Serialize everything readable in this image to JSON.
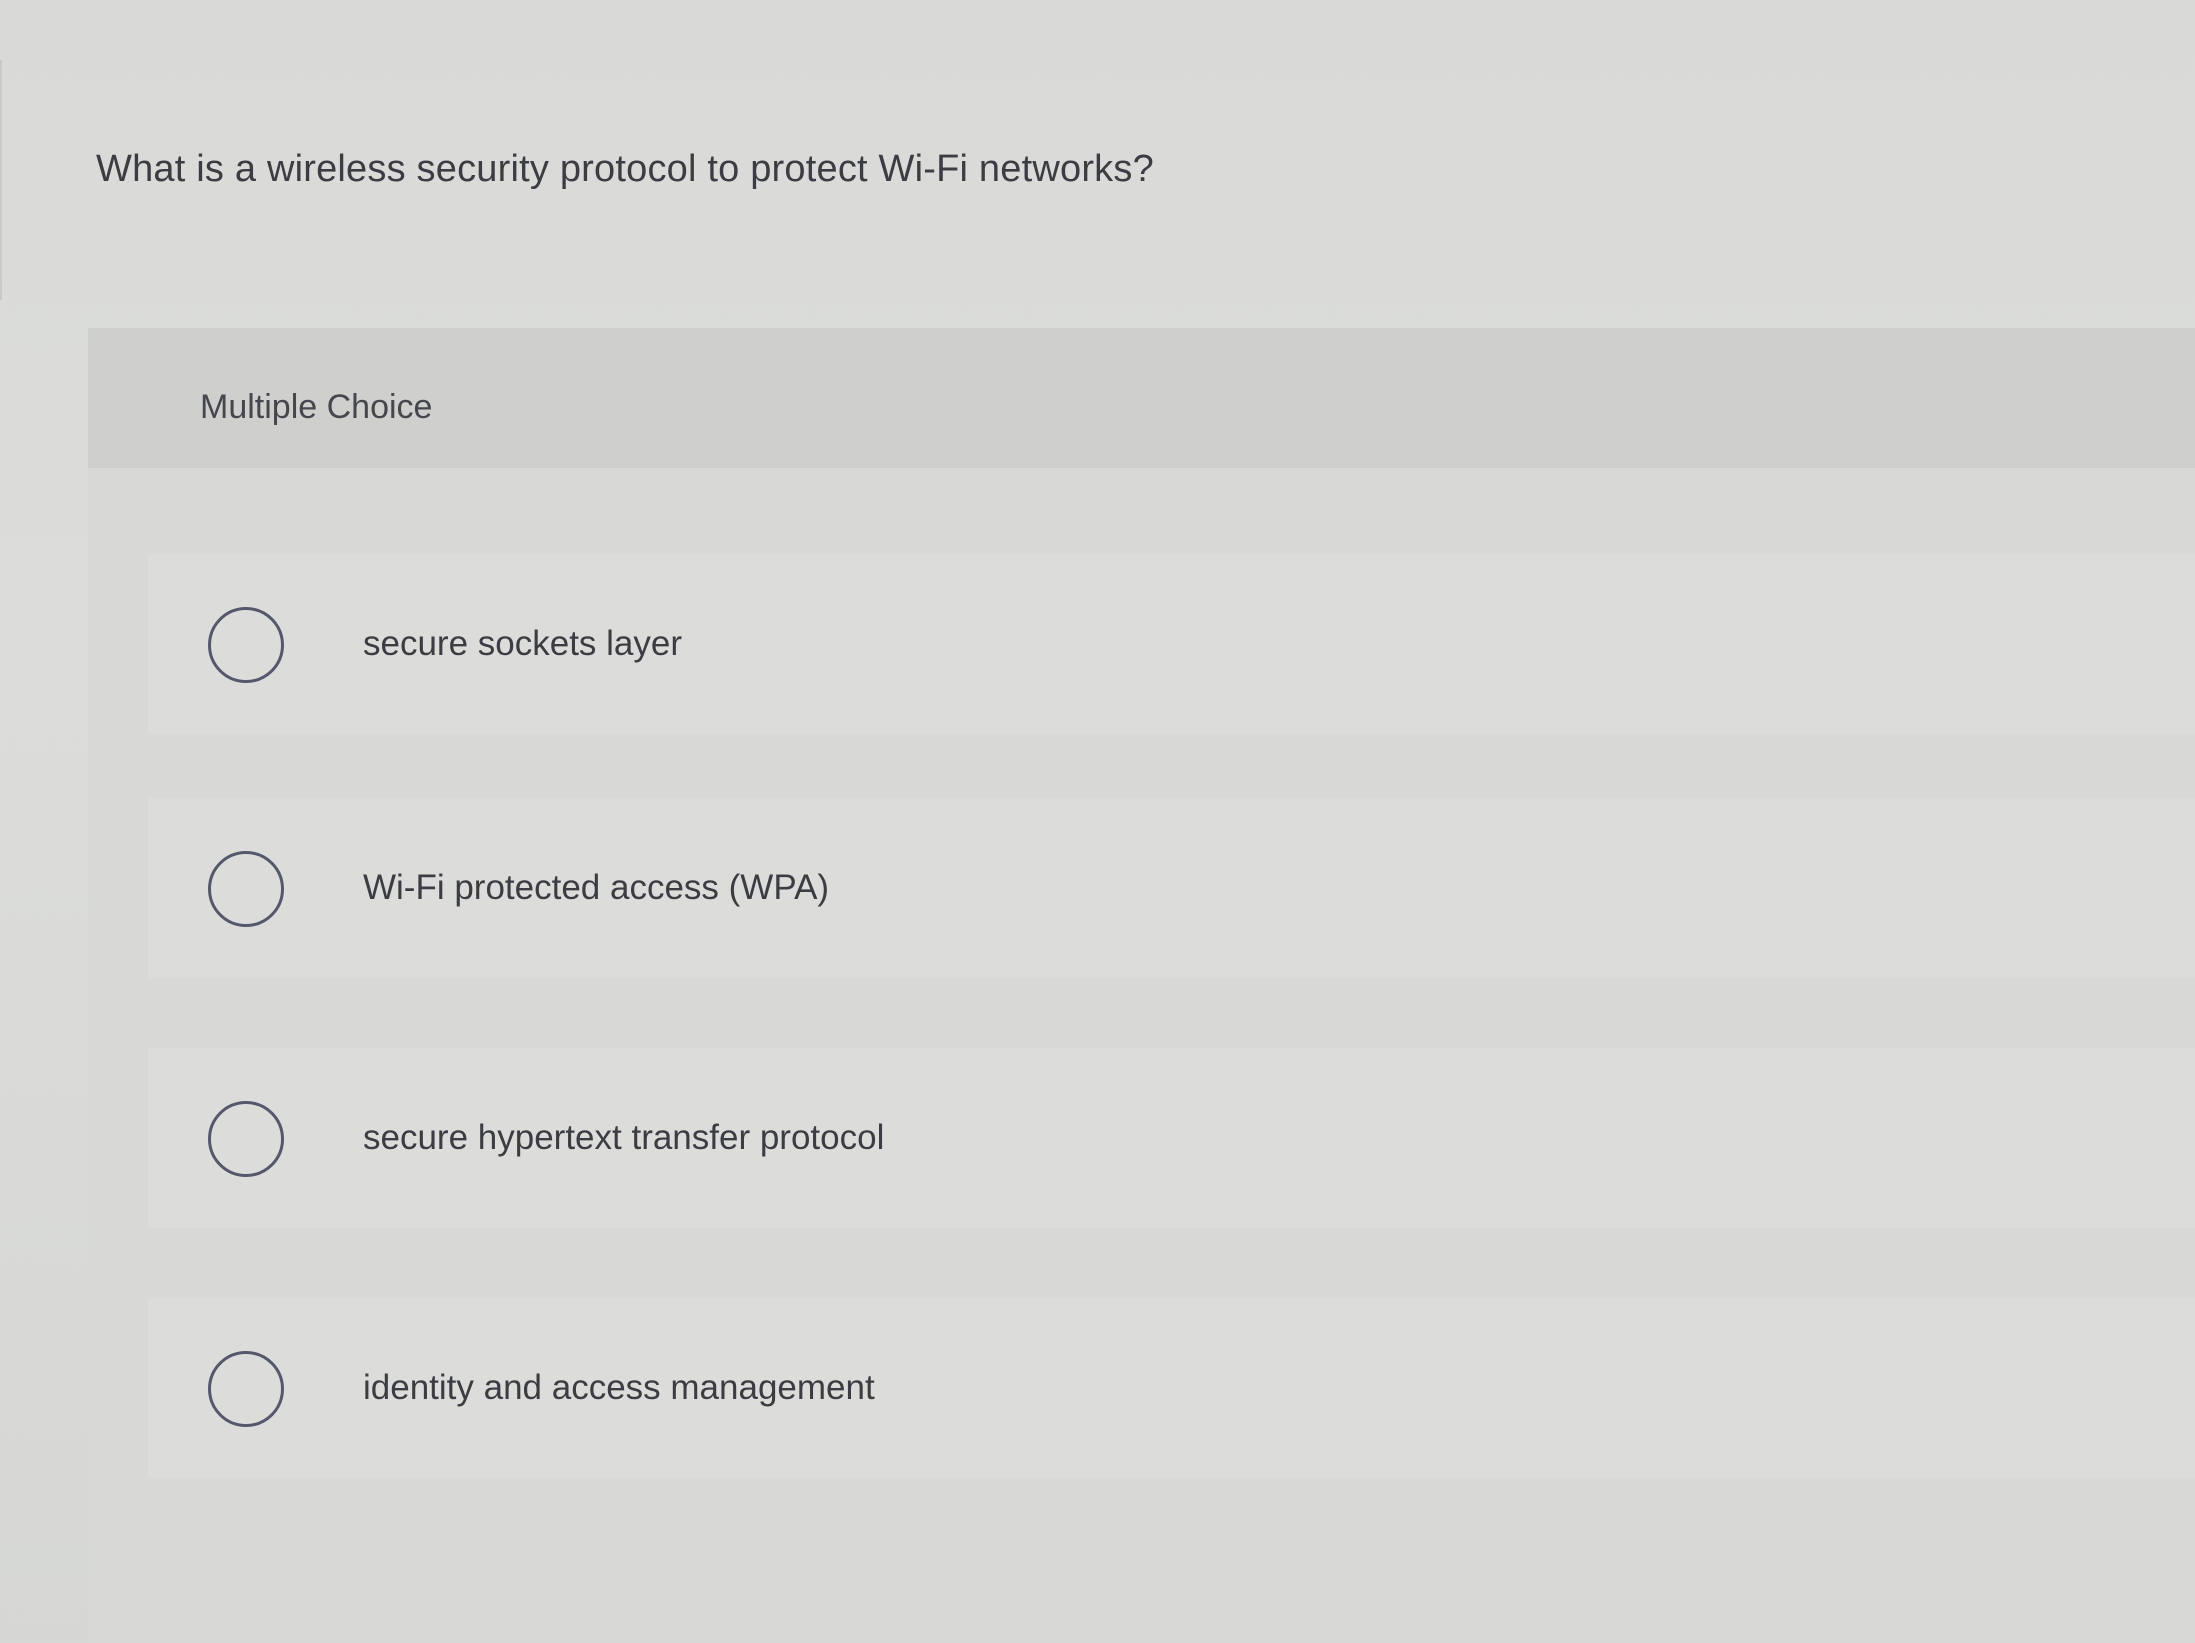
{
  "question": {
    "text": "What is a wireless security protocol to protect Wi-Fi networks?"
  },
  "choice_block": {
    "type_label": "Multiple Choice",
    "options": [
      {
        "label": "secure sockets layer",
        "selected": false
      },
      {
        "label": "Wi-Fi protected access (WPA)",
        "selected": false
      },
      {
        "label": "secure hypertext transfer protocol",
        "selected": false
      },
      {
        "label": "identity and access management",
        "selected": false
      }
    ]
  }
}
